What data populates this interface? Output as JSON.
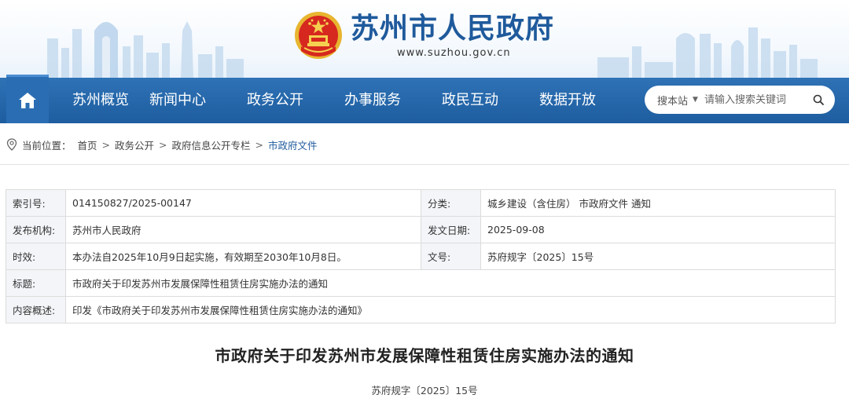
{
  "header": {
    "site_title": "苏州市人民政府",
    "site_url": "www.suzhou.gov.cn",
    "brand_color": "#1f5a9c"
  },
  "nav": {
    "home_icon": "home-icon",
    "items": [
      "苏州概览",
      "新闻中心",
      "政务公开",
      "办事服务",
      "政民互动",
      "数据开放"
    ],
    "search": {
      "scope": "搜本站",
      "placeholder": "请输入搜索关键词",
      "icon": "search-icon"
    },
    "bar_color": "#2366a9"
  },
  "breadcrumb": {
    "prefix": "当前位置：",
    "items": [
      "首页",
      "政务公开",
      "政府信息公开专栏",
      "市政府文件"
    ]
  },
  "meta": {
    "index_label": "索引号:",
    "index_value": "014150827/2025-00147",
    "category_label": "分类:",
    "category_value": "城乡建设（含住房） 市政府文件 通知",
    "publisher_label": "发布机构:",
    "publisher_value": "苏州市人民政府",
    "date_label": "发文日期:",
    "date_value": "2025-09-08",
    "validity_label": "时效:",
    "validity_value": "本办法自2025年10月9日起实施，有效期至2030年10月8日。",
    "docno_label": "文号:",
    "docno_value": "苏府规字〔2025〕15号",
    "title_label": "标题:",
    "title_value": "市政府关于印发苏州市发展保障性租赁住房实施办法的通知",
    "summary_label": "内容概述:",
    "summary_value": "印发《市政府关于印发苏州市发展保障性租赁住房实施办法的通知》"
  },
  "article": {
    "title": "市政府关于印发苏州市发展保障性租赁住房实施办法的通知",
    "doc_number": "苏府规字〔2025〕15号"
  }
}
